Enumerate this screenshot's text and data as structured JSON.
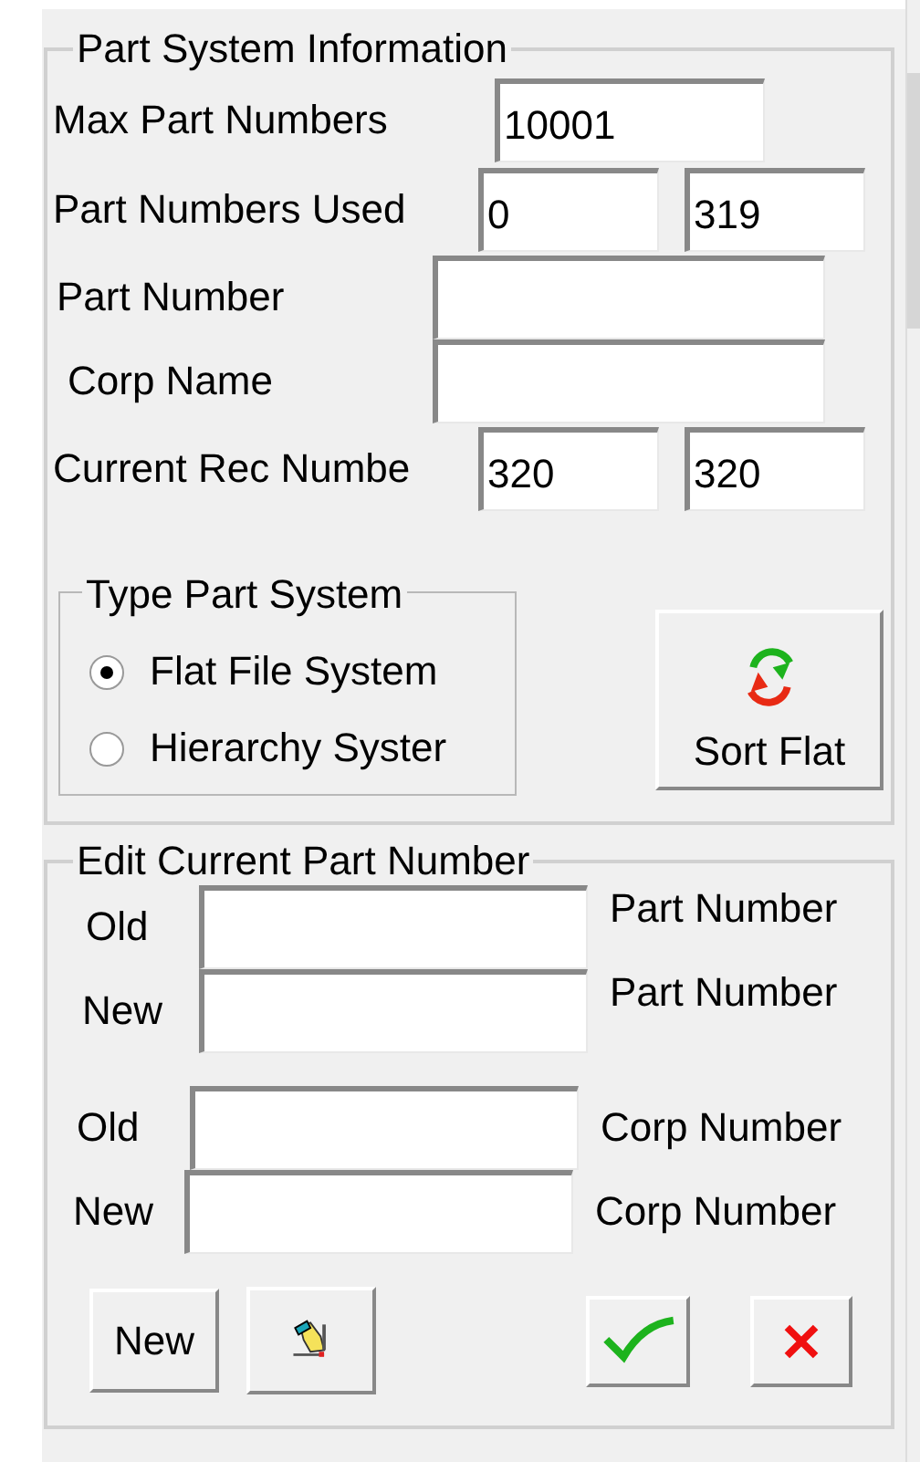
{
  "info_group": {
    "title": "Part System Information",
    "rows": [
      {
        "kind": "single",
        "label": "Max Part Numbers",
        "values": [
          "10001"
        ]
      },
      {
        "kind": "pair",
        "label": "Part Numbers Used",
        "values": [
          "0",
          "319"
        ]
      },
      {
        "kind": "wide",
        "label": "Part Number"
      },
      {
        "kind": "wide",
        "label": "Corp Name"
      },
      {
        "kind": "pair",
        "label": "Current Rec Numbe",
        "values": [
          "320",
          "320"
        ]
      }
    ]
  },
  "type_group": {
    "title": "Type Part System",
    "options": [
      {
        "label": "Flat File System",
        "selected": true
      },
      {
        "label": "Hierarchy Syster",
        "selected": false
      }
    ]
  },
  "sort_button": {
    "label": "Sort Flat"
  },
  "edit_group": {
    "title": "Edit Current Part Number",
    "rows": [
      {
        "label": "Old",
        "caption": "Part Number"
      },
      {
        "label": "New",
        "caption": "Part Number"
      },
      {
        "label": "Old",
        "caption": "Corp Number"
      },
      {
        "label": "New",
        "caption": "Corp Number"
      }
    ],
    "buttons": [
      {
        "kind": "text",
        "label": "New"
      },
      {
        "kind": "edit"
      },
      {
        "kind": "ok"
      },
      {
        "kind": "cancel"
      }
    ]
  }
}
